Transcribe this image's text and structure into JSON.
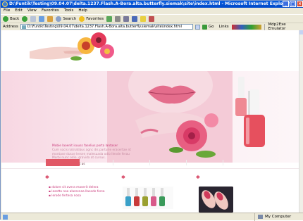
{
  "window": {
    "title": "D:\\Funtik\\Testing\\09.04.07\\delta.1237.Flash.A-Bora.alta.butterfly.siemak\\site\\index.html - Microsoft Internet Explorer",
    "controls": [
      "_",
      "□",
      "×"
    ]
  },
  "menu": {
    "items": [
      "File",
      "Edit",
      "View",
      "Favorites",
      "Tools",
      "Help"
    ]
  },
  "toolbar": {
    "back_label": "Back",
    "search_label": "Search",
    "favorites_label": "Favorites"
  },
  "address": {
    "label": "Address",
    "value": "D:\\Funtik\\Testing\\09.04.07\\delta.1237.Flash.A-Bora.alta.butterfly.siemak\\site\\index.html",
    "go_label": "Go",
    "links_label": "Links",
    "extra_label": "Mdp2Exe Emulator"
  },
  "banner": {
    "title": "Mobie laoenit isuuss faselius porta lantaser",
    "body": "Cum socis natnatibus agnc dis parturie erasertae nt montase dusce lersen malesuada odio llende ferau Morbi nunc odio, gravida at cursus.",
    "more": "read more about us"
  },
  "links": {
    "items": [
      "dolore sit avera maserit delera",
      "lasetto noa alaresnaa llaesde fersa",
      "lerode fertesa nosa"
    ]
  },
  "status": {
    "right": "My Computer"
  },
  "colors": {
    "accent": "#c9397a",
    "nav_active": "#e15866",
    "titlebar": "#0a5ee0"
  }
}
